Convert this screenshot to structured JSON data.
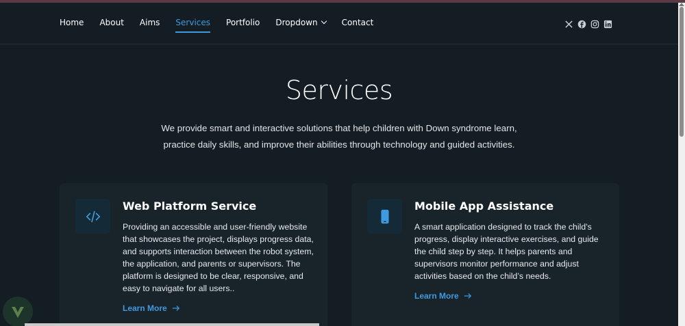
{
  "nav": {
    "items": [
      {
        "label": "Home",
        "active": false
      },
      {
        "label": "About",
        "active": false
      },
      {
        "label": "Aims",
        "active": false
      },
      {
        "label": "Services",
        "active": true
      },
      {
        "label": "Portfolio",
        "active": false
      },
      {
        "label": "Dropdown",
        "active": false,
        "has_dropdown": true
      },
      {
        "label": "Contact",
        "active": false
      }
    ],
    "social": [
      "x-icon",
      "facebook-icon",
      "instagram-icon",
      "linkedin-icon"
    ]
  },
  "hero": {
    "title": "Services",
    "intro": "We provide smart and interactive solutions that help children with Down syndrome learn, practice daily skills, and improve their abilities through technology and guided activities."
  },
  "cards": [
    {
      "icon": "code-icon",
      "title": "Web Platform Service",
      "text": "Providing an accessible and user-friendly website that showcases the project, displays progress data, and supports interaction between the robot system, the application, and parents or supervisors. The platform is designed to be clear, responsive, and easy to navigate for all users..",
      "link": "Learn More"
    },
    {
      "icon": "phone-icon",
      "title": "Mobile App Assistance",
      "text": "A smart application designed to track the child’s progress, display interactive exercises, and guide the child step by step. It helps parents and supervisors monitor performance and adjust activities based on the child’s needs.",
      "link": "Learn More"
    }
  ],
  "colors": {
    "accent": "#3f9ae0",
    "background": "#141d23",
    "card": "#18232a"
  }
}
